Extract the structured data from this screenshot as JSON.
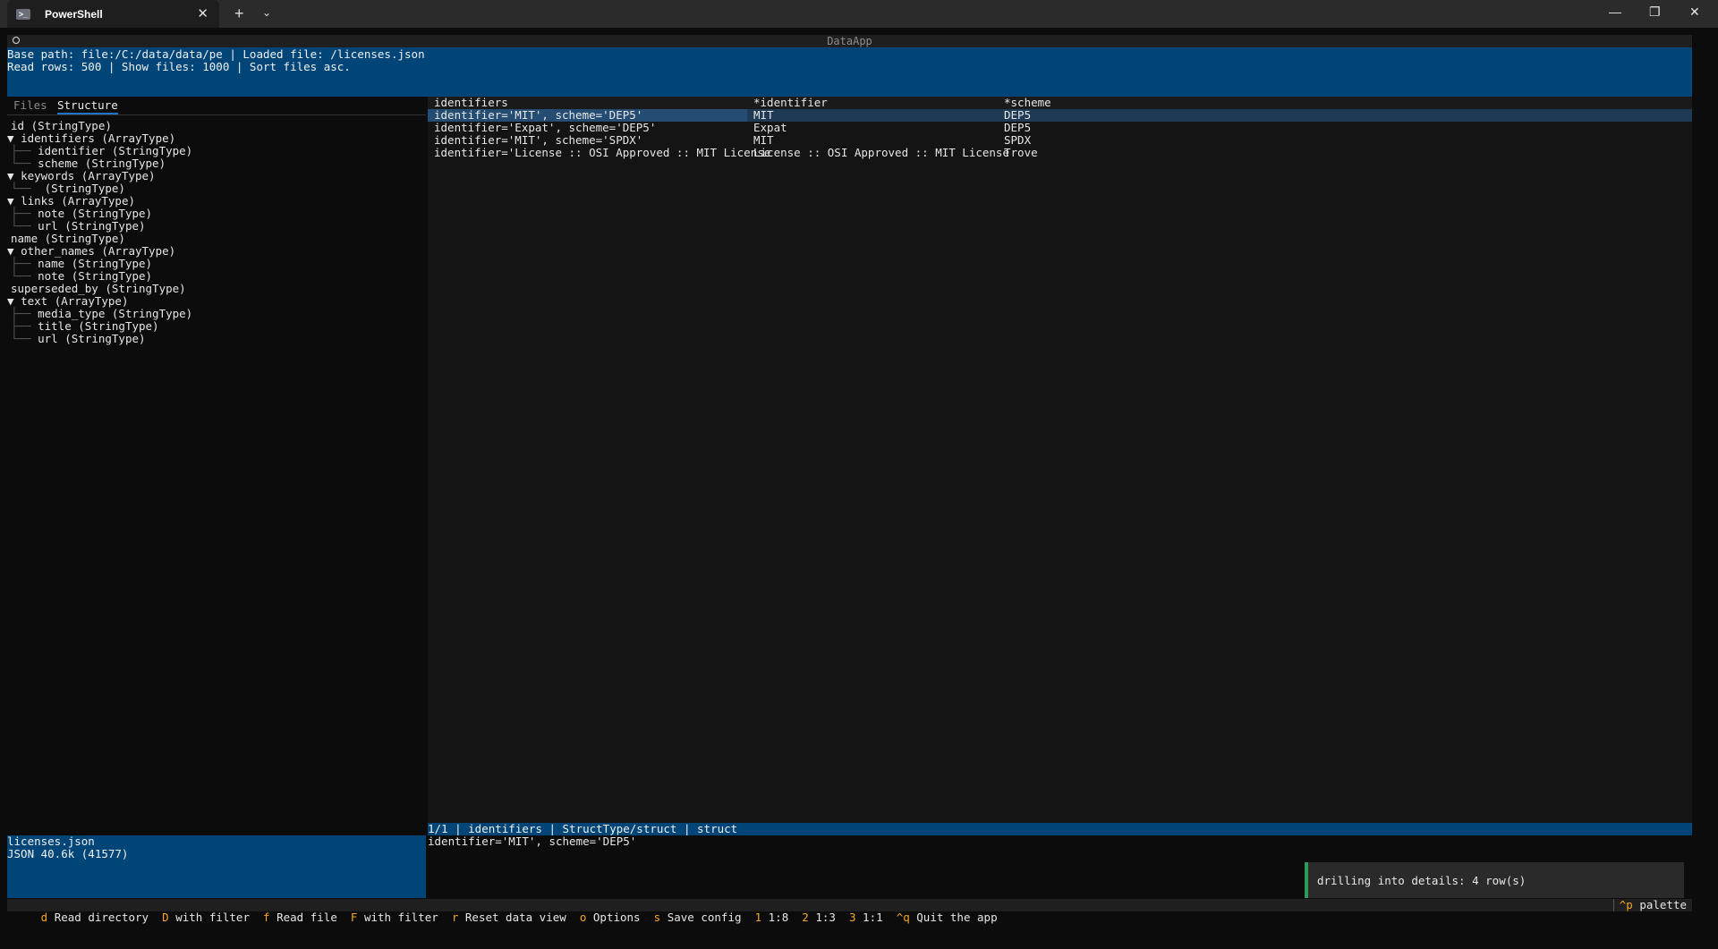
{
  "window": {
    "tab_title": "PowerShell",
    "new_tab": "+",
    "dropdown": "⌄",
    "minimize": "—",
    "maximize": "❐",
    "close": "✕"
  },
  "app": {
    "title": "DataApp",
    "header_line1": "Base path: file:/C:/data/data/pe | Loaded file: /licenses.json",
    "header_line2": "Read rows: 500 | Show files: 1000 | Sort files asc."
  },
  "left": {
    "tabs": [
      "Files",
      "Structure"
    ],
    "tree": [
      {
        "prefix": "",
        "text": "id (StringType)"
      },
      {
        "prefix": "▼ ",
        "text": "identifiers (ArrayType)"
      },
      {
        "prefix": "├── ",
        "text": "identifier (StringType)"
      },
      {
        "prefix": "└── ",
        "text": "scheme (StringType)"
      },
      {
        "prefix": "▼ ",
        "text": "keywords (ArrayType)"
      },
      {
        "prefix": "└── ",
        "text": " (StringType)"
      },
      {
        "prefix": "▼ ",
        "text": "links (ArrayType)"
      },
      {
        "prefix": "├── ",
        "text": "note (StringType)"
      },
      {
        "prefix": "└── ",
        "text": "url (StringType)"
      },
      {
        "prefix": "",
        "text": "name (StringType)"
      },
      {
        "prefix": "▼ ",
        "text": "other_names (ArrayType)"
      },
      {
        "prefix": "├── ",
        "text": "name (StringType)"
      },
      {
        "prefix": "└── ",
        "text": "note (StringType)"
      },
      {
        "prefix": "",
        "text": "superseded_by (StringType)"
      },
      {
        "prefix": "▼ ",
        "text": "text (ArrayType)"
      },
      {
        "prefix": "├── ",
        "text": "media_type (StringType)"
      },
      {
        "prefix": "├── ",
        "text": "title (StringType)"
      },
      {
        "prefix": "└── ",
        "text": "url (StringType)"
      }
    ],
    "file_name": "licenses.json",
    "file_info": "JSON 40.6k (41577)"
  },
  "grid": {
    "headers": [
      "identifiers",
      "*identifier",
      "*scheme"
    ],
    "rows": [
      [
        "identifier='MIT', scheme='DEP5'",
        "MIT",
        "DEP5"
      ],
      [
        "identifier='Expat', scheme='DEP5'",
        "Expat",
        "DEP5"
      ],
      [
        "identifier='MIT', scheme='SPDX'",
        "MIT",
        "SPDX"
      ],
      [
        "identifier='License :: OSI Approved :: MIT License",
        "License :: OSI Approved :: MIT License",
        "Trove"
      ]
    ]
  },
  "status": "1/1 | identifiers | StructType/struct | struct",
  "detail": "identifier='MIT', scheme='DEP5'",
  "toast": "drilling into details: 4 row(s)",
  "footer": {
    "keys": [
      {
        "key": "d",
        "label": "Read directory"
      },
      {
        "key": "D",
        "label": "with filter"
      },
      {
        "key": "f",
        "label": "Read file"
      },
      {
        "key": "F",
        "label": "with filter"
      },
      {
        "key": "r",
        "label": "Reset data view"
      },
      {
        "key": "o",
        "label": "Options"
      },
      {
        "key": "s",
        "label": "Save config"
      },
      {
        "key": "1",
        "label": "1:8"
      },
      {
        "key": "2",
        "label": "1:3"
      },
      {
        "key": "3",
        "label": "1:1"
      },
      {
        "key": "^q",
        "label": "Quit the app"
      }
    ],
    "palette_key": "^p",
    "palette_label": "palette"
  }
}
